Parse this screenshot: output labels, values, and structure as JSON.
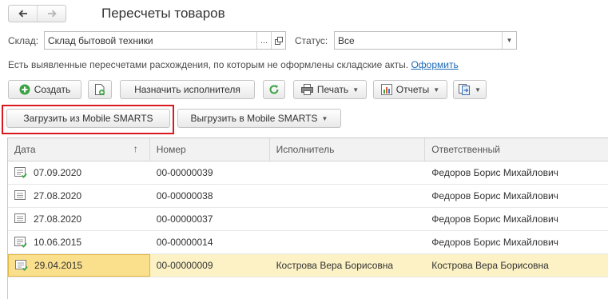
{
  "window": {
    "title": "Пересчеты товаров"
  },
  "nav": {
    "back_icon": "arrow-left-icon",
    "forward_icon": "arrow-right-icon"
  },
  "filters": {
    "warehouse_label": "Склад:",
    "warehouse_value": "Склад бытовой техники",
    "warehouse_select_glyph": "...",
    "status_label": "Статус:",
    "status_value": "Все"
  },
  "info": {
    "text": "Есть выявленные пересчетами расхождения, по которым не оформлены складские акты.",
    "link": "Оформить"
  },
  "toolbar": {
    "create": "Создать",
    "assign": "Назначить исполнителя",
    "print": "Печать",
    "reports": "Отчеты"
  },
  "toolbar2": {
    "load": "Загрузить из Mobile SMARTS",
    "unload": "Выгрузить в Mobile SMARTS"
  },
  "colors": {
    "accent_link": "#1c6ab5",
    "highlight_frame": "#d9181f",
    "selected_row": "#fcf2c5",
    "selected_cell": "#fae08c",
    "create_icon_green": "#3ca345"
  },
  "table": {
    "columns": [
      "Дата",
      "Номер",
      "Исполнитель",
      "Ответственный"
    ],
    "sort_indicator": "↑",
    "rows": [
      {
        "date": "07.09.2020",
        "number": "00-00000039",
        "executor": "",
        "responsible": "Федоров Борис Михайлович",
        "icon": "document-posted-icon"
      },
      {
        "date": "27.08.2020",
        "number": "00-00000038",
        "executor": "",
        "responsible": "Федоров Борис Михайлович",
        "icon": "document-icon"
      },
      {
        "date": "27.08.2020",
        "number": "00-00000037",
        "executor": "",
        "responsible": "Федоров Борис Михайлович",
        "icon": "document-icon"
      },
      {
        "date": "10.06.2015",
        "number": "00-00000014",
        "executor": "",
        "responsible": "Федоров Борис Михайлович",
        "icon": "document-posted-icon"
      },
      {
        "date": "29.04.2015",
        "number": "00-00000009",
        "executor": "Кострова Вера Борисовна",
        "responsible": "Кострова Вера Борисовна",
        "icon": "document-posted-icon",
        "selected": true
      }
    ]
  }
}
